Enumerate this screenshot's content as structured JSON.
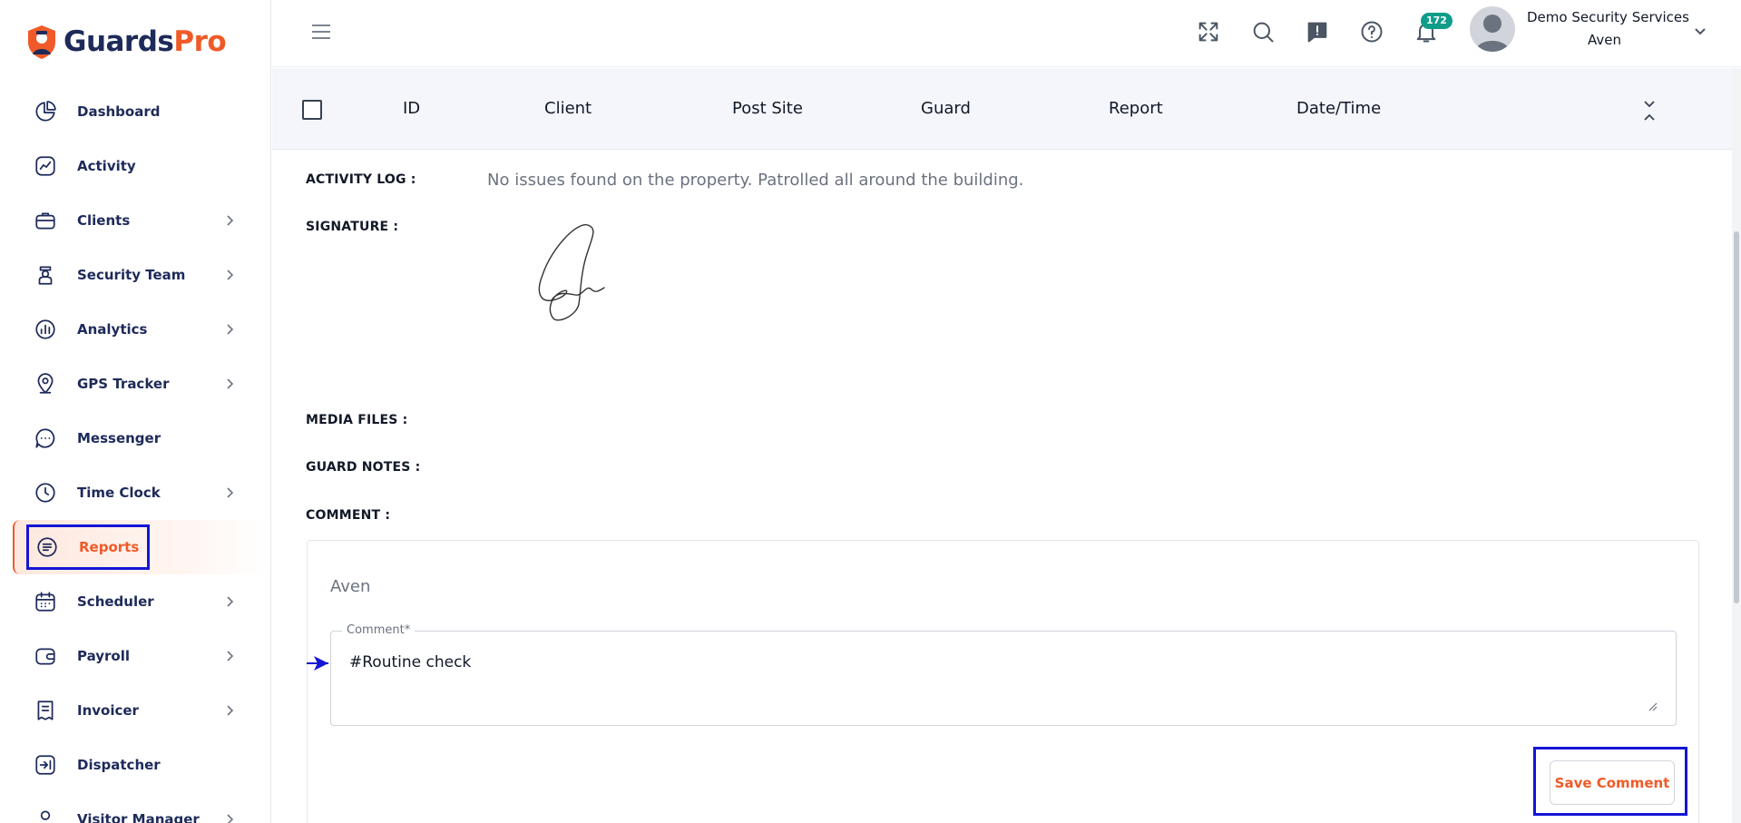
{
  "brand": {
    "part1": "Guards",
    "part2": "Pro"
  },
  "sidebar": {
    "items": [
      {
        "label": "Dashboard"
      },
      {
        "label": "Activity"
      },
      {
        "label": "Clients"
      },
      {
        "label": "Security Team"
      },
      {
        "label": "Analytics"
      },
      {
        "label": "GPS Tracker"
      },
      {
        "label": "Messenger"
      },
      {
        "label": "Time Clock"
      },
      {
        "label": "Reports"
      },
      {
        "label": "Scheduler"
      },
      {
        "label": "Payroll"
      },
      {
        "label": "Invoicer"
      },
      {
        "label": "Dispatcher"
      },
      {
        "label": "Visitor Manager"
      }
    ],
    "active": "Reports"
  },
  "header": {
    "notification_count": "172",
    "user_name": "Demo Security Services",
    "user_sub": "Aven"
  },
  "table": {
    "columns": [
      "ID",
      "Client",
      "Post Site",
      "Guard",
      "Report",
      "Date/Time"
    ]
  },
  "details": {
    "activity_log_label": "ACTIVITY LOG :",
    "activity_log_value": "No issues found on the property. Patrolled all around the building.",
    "signature_label": "SIGNATURE :",
    "media_files_label": "MEDIA FILES :",
    "guard_notes_label": "GUARD NOTES :",
    "comment_label": "COMMENT :"
  },
  "comment": {
    "author": "Aven",
    "legend": "Comment*",
    "value": "#Routine check",
    "save_label": "Save Comment"
  },
  "colors": {
    "brand_navy": "#1e2a5a",
    "brand_orange": "#f05a28",
    "badge_teal": "#0f9d8a",
    "highlight_blue": "#1515d6"
  }
}
